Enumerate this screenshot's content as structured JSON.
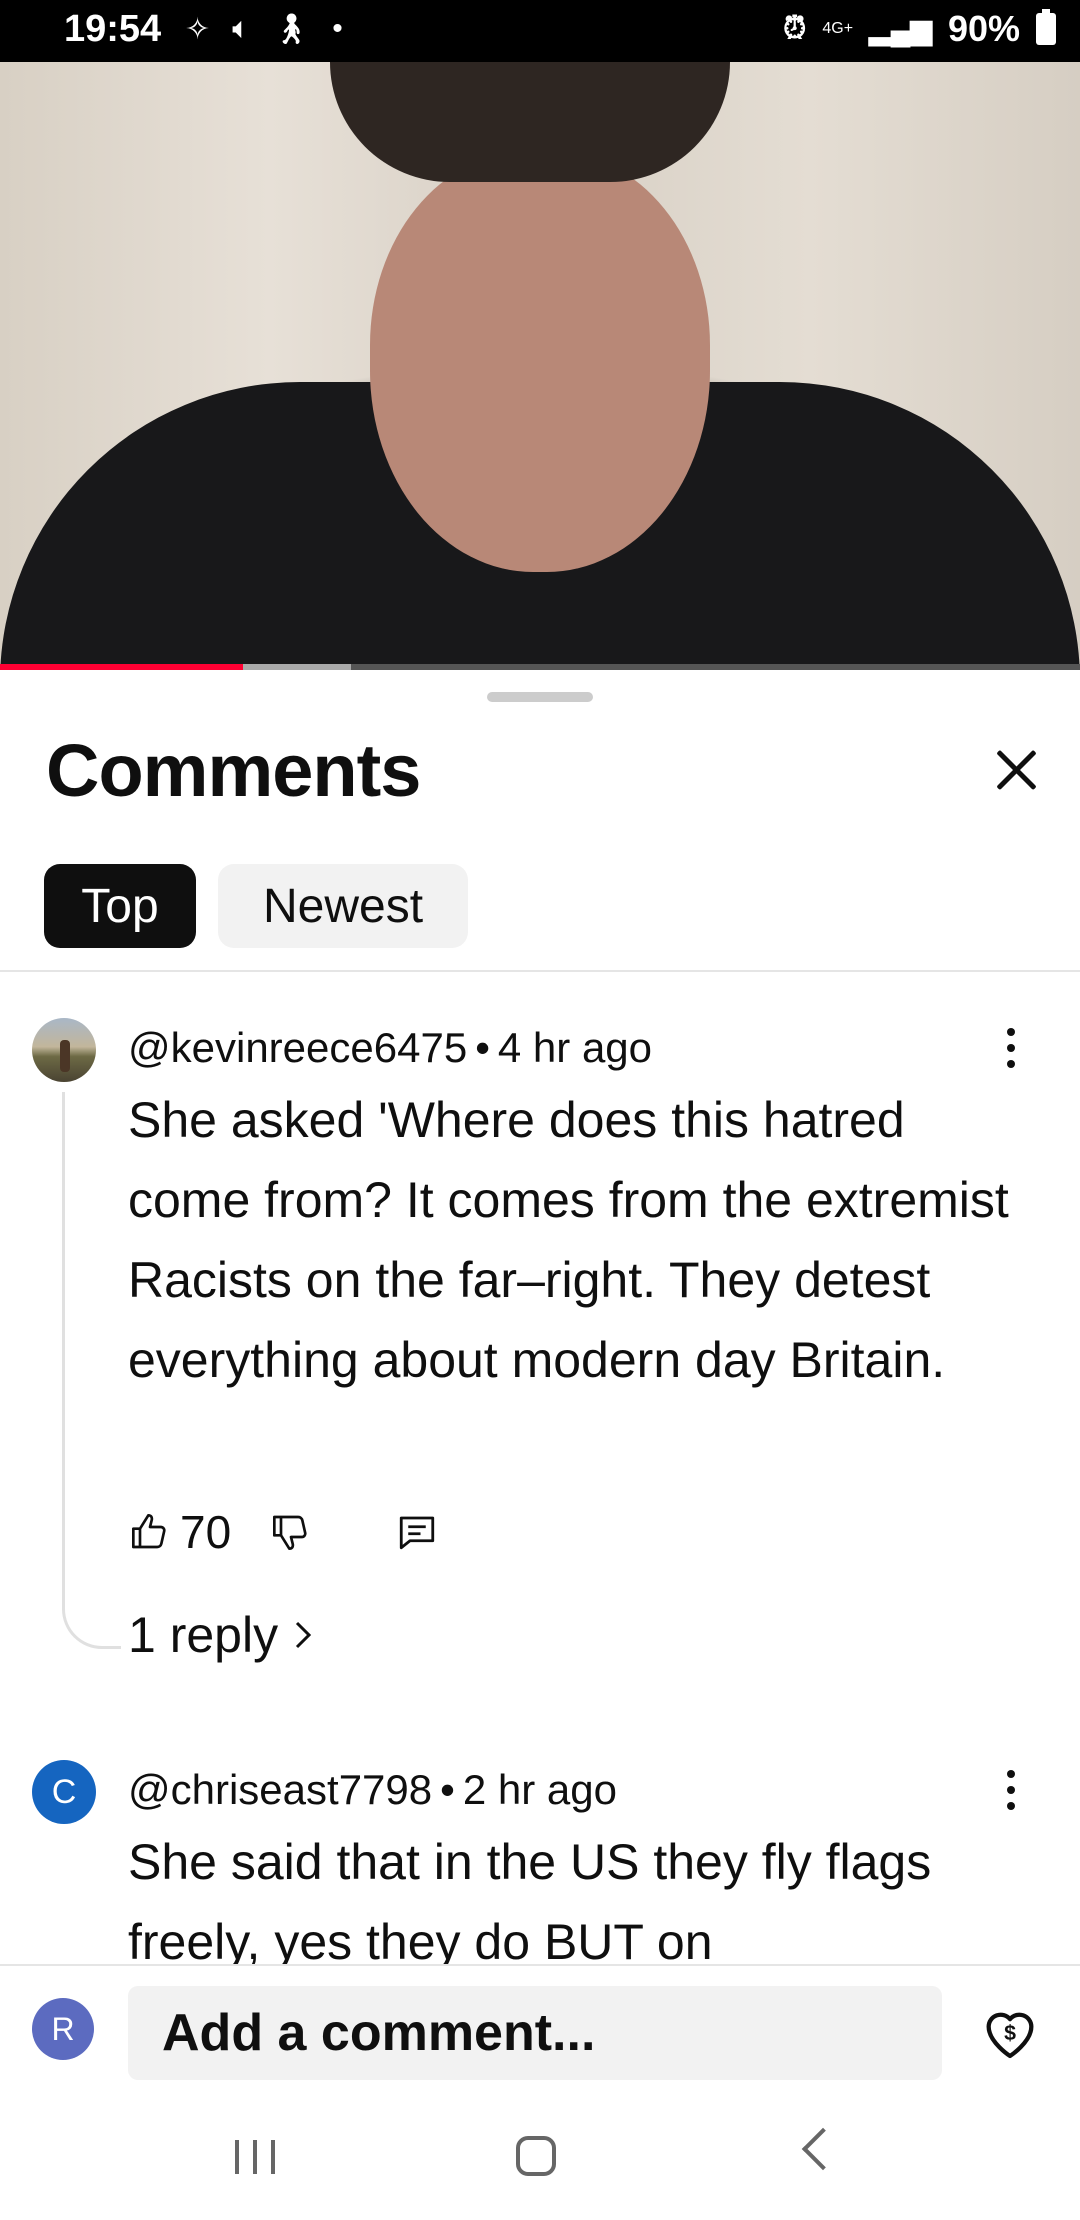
{
  "status_bar": {
    "time": "19:54",
    "left_icons": [
      "voice-ai-icon",
      "volume-icon",
      "accessibility-icon",
      "dot-icon"
    ],
    "network": "4G+",
    "battery": "90%"
  },
  "video": {
    "progress_played": 0.225,
    "progress_buffered": 0.325
  },
  "sheet": {
    "title": "Comments",
    "close_icon": "close-icon",
    "chips": {
      "top": "Top",
      "newest": "Newest"
    }
  },
  "comments": [
    {
      "author": "@kevinreece6475",
      "time": "4 hr ago",
      "text": "She asked 'Where does this hatred come from? It comes from the extremist Racists on the far–right. They detest everything about modern day Britain.",
      "likes": "70",
      "replies": "1 reply"
    },
    {
      "author": "@chriseast7798",
      "avatar_letter": "C",
      "time": "2 hr ago",
      "text": "She said that in the US they fly flags freely, yes they do BUT on"
    }
  ],
  "comment_bar": {
    "avatar_letter": "R",
    "placeholder": "Add a comment..."
  },
  "colors": {
    "progress_red": "#ff0033",
    "chip_selected_bg": "#0f0f0f",
    "avatar_c": "#1565c0",
    "avatar_r": "#5c6bc0"
  }
}
